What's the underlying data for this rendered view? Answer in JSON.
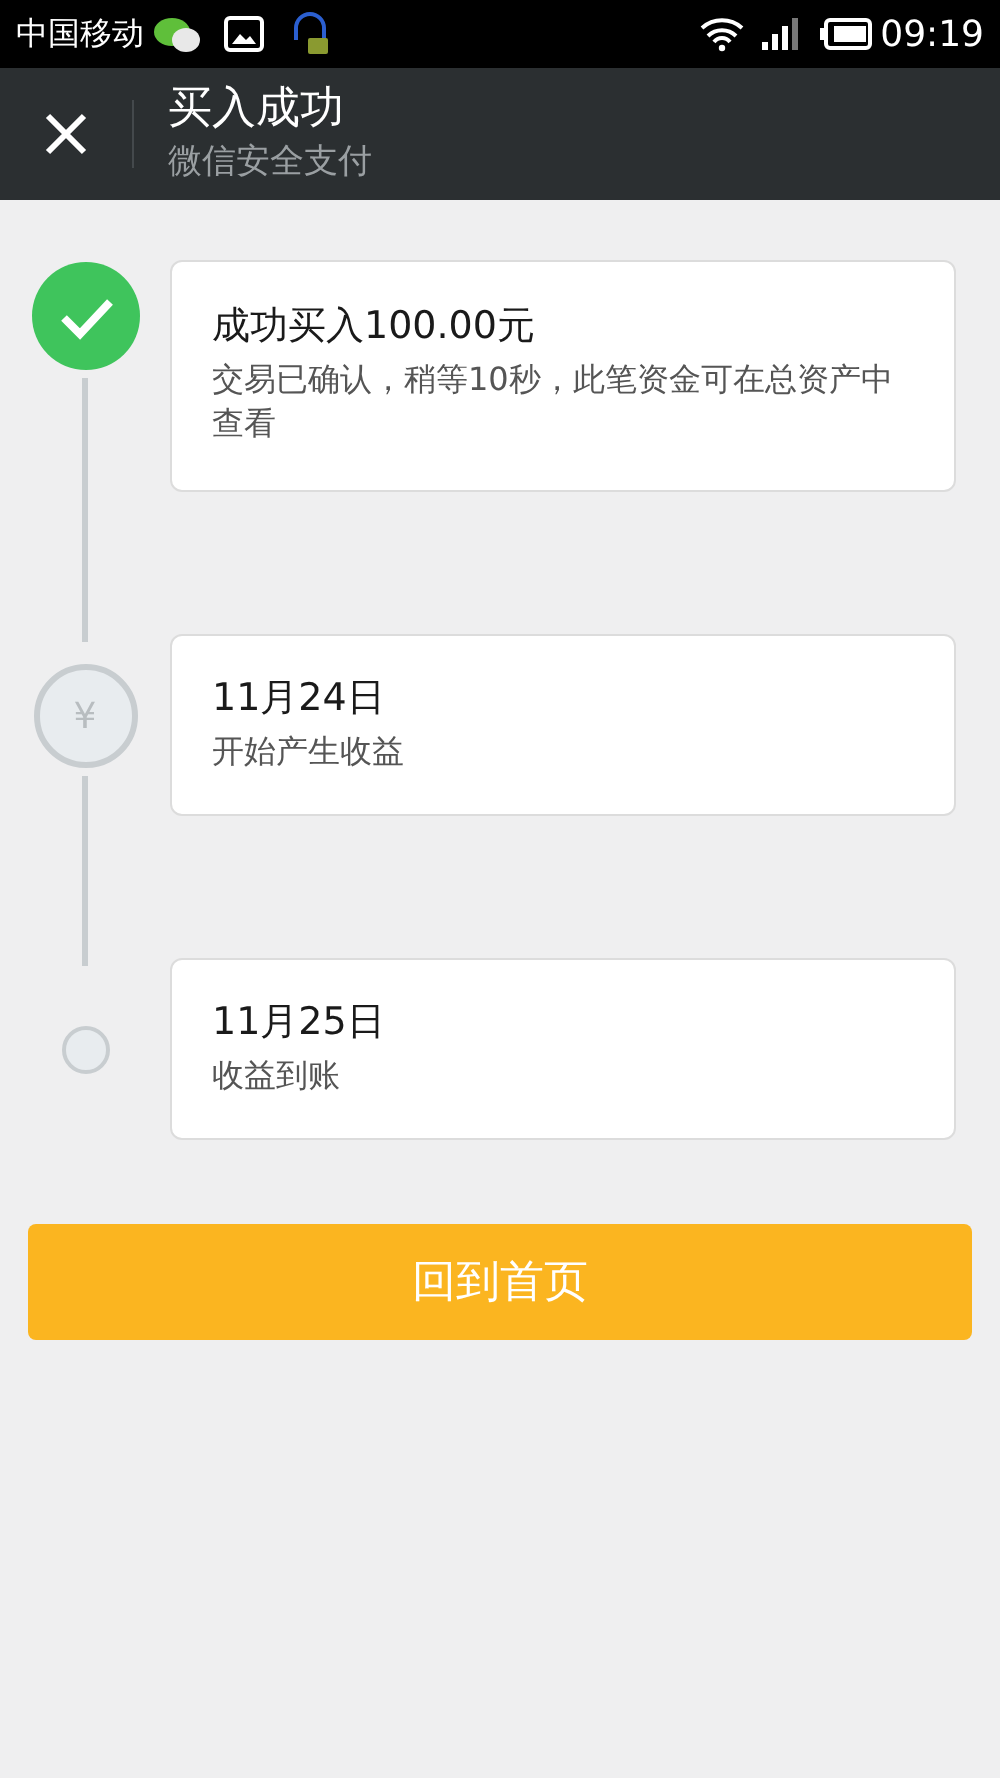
{
  "status_bar": {
    "carrier": "中国移动",
    "time": "09:19"
  },
  "header": {
    "title": "买入成功",
    "subtitle": "微信安全支付"
  },
  "steps": [
    {
      "kind": "done",
      "title": "成功买入100.00元",
      "detail": "交易已确认，稍等10秒，此笔资金可在总资产中查看"
    },
    {
      "kind": "yen",
      "marker": "¥",
      "title": "11月24日",
      "detail": "开始产生收益"
    },
    {
      "kind": "dot",
      "title": "11月25日",
      "detail": "收益到账"
    }
  ],
  "button": {
    "label": "回到首页"
  }
}
